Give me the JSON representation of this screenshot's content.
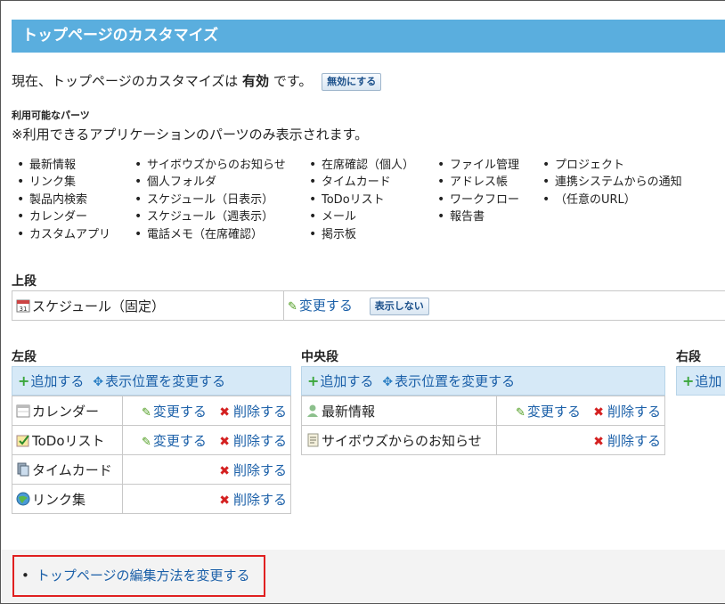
{
  "page_title": "トップページのカスタマイズ",
  "status": {
    "prefix": "現在、トップページのカスタマイズは",
    "value": "有効",
    "suffix": "です。",
    "disable_button": "無効にする"
  },
  "parts": {
    "heading": "利用可能なパーツ",
    "note": "※利用できるアプリケーションのパーツのみ表示されます。",
    "columns": [
      [
        "最新情報",
        "リンク集",
        "製品内検索",
        "カレンダー",
        "カスタムアプリ"
      ],
      [
        "サイボウズからのお知らせ",
        "個人フォルダ",
        "スケジュール（日表示）",
        "スケジュール（週表示）",
        "電話メモ（在席確認）"
      ],
      [
        "在席確認（個人）",
        "タイムカード",
        "ToDoリスト",
        "メール",
        "掲示板"
      ],
      [
        "ファイル管理",
        "アドレス帳",
        "ワークフロー",
        "報告書"
      ],
      [
        "プロジェクト",
        "連携システムからの通知",
        "（任意のURL）"
      ]
    ]
  },
  "upper": {
    "label": "上段",
    "item": "スケジュール（固定）",
    "change": "変更する",
    "hide_button": "表示しない"
  },
  "left": {
    "label": "左段",
    "add": "追加する",
    "move": "表示位置を変更する",
    "rows": [
      {
        "name": "カレンダー",
        "change": "変更する",
        "delete": "削除する"
      },
      {
        "name": "ToDoリスト",
        "change": "変更する",
        "delete": "削除する"
      },
      {
        "name": "タイムカード",
        "delete": "削除する"
      },
      {
        "name": "リンク集",
        "delete": "削除する"
      }
    ]
  },
  "center": {
    "label": "中央段",
    "add": "追加する",
    "move": "表示位置を変更する",
    "rows": [
      {
        "name": "最新情報",
        "change": "変更する",
        "delete": "削除する"
      },
      {
        "name": "サイボウズからのお知らせ",
        "delete": "削除する"
      }
    ]
  },
  "right": {
    "label": "右段",
    "add": "追加"
  },
  "footer": {
    "link": "トップページの編集方法を変更する"
  },
  "colors": {
    "title_bar": "#5aaede",
    "link": "#1a5fa8",
    "header_bg": "#d6e9f7",
    "highlight_border": "#e02020"
  }
}
